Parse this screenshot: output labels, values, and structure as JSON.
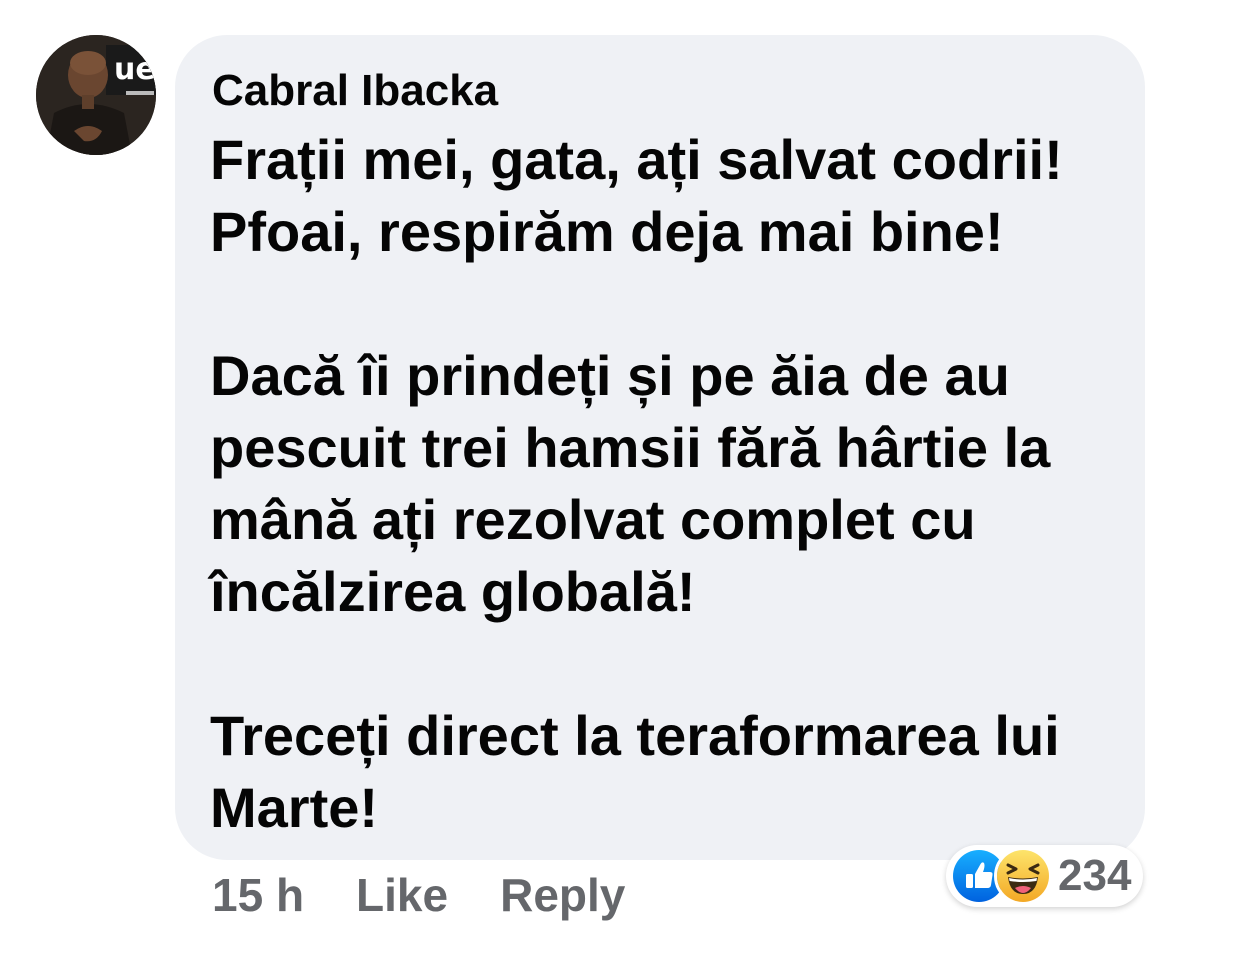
{
  "comment": {
    "author": "Cabral Ibacka",
    "lines": [
      "Frații mei, gata, ați salvat codrii!",
      "Pfoai, respirăm deja mai bine!",
      "",
      "Dacă îi prindeți și pe ăia de au",
      "pescuit trei hamsii fără hârtie la",
      "mână ați rezolvat complet cu",
      "încălzirea globală!",
      "",
      "Treceți direct la teraformarea lui",
      "Marte!"
    ],
    "timestamp": "15 h",
    "like_label": "Like",
    "reply_label": "Reply",
    "reactions": {
      "icons": [
        "like-icon",
        "haha-icon"
      ],
      "count": "234"
    }
  },
  "colors": {
    "bubble": "#eff1f5",
    "text": "#050505",
    "secondary_text": "#65676b",
    "like_blue": "#1b74e4",
    "haha_yellow": "#f7c53f"
  }
}
